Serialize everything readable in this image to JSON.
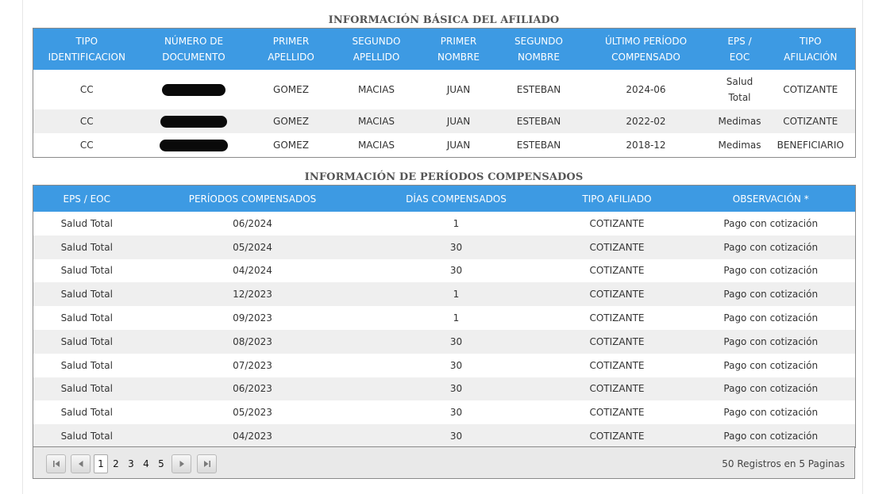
{
  "basic_section": {
    "title": "INFORMACIÓN BÁSICA DEL AFILIADO",
    "headers": [
      "TIPO\nIDENTIFICACION",
      "NÚMERO DE\nDOCUMENTO",
      "PRIMER\nAPELLIDO",
      "SEGUNDO\nAPELLIDO",
      "PRIMER\nNOMBRE",
      "SEGUNDO\nNOMBRE",
      "ÚLTIMO PERÍODO\nCOMPENSADO",
      "EPS /\nEOC",
      "TIPO\nAFILIACIÓN"
    ],
    "rows": [
      {
        "tipo": "CC",
        "primer_apellido": "GOMEZ",
        "segundo_apellido": "MACIAS",
        "primer_nombre": "JUAN",
        "segundo_nombre": "ESTEBAN",
        "ultimo_periodo": "2024-06",
        "eps": "Salud\nTotal",
        "tipo_afiliacion": "COTIZANTE"
      },
      {
        "tipo": "CC",
        "primer_apellido": "GOMEZ",
        "segundo_apellido": "MACIAS",
        "primer_nombre": "JUAN",
        "segundo_nombre": "ESTEBAN",
        "ultimo_periodo": "2022-02",
        "eps": "Medimas",
        "tipo_afiliacion": "COTIZANTE"
      },
      {
        "tipo": "CC",
        "primer_apellido": "GOMEZ",
        "segundo_apellido": "MACIAS",
        "primer_nombre": "JUAN",
        "segundo_nombre": "ESTEBAN",
        "ultimo_periodo": "2018-12",
        "eps": "Medimas",
        "tipo_afiliacion": "BENEFICIARIO"
      }
    ]
  },
  "periods_section": {
    "title": "INFORMACIÓN DE PERÍODOS COMPENSADOS",
    "headers": [
      "EPS / EOC",
      "PERÍODOS COMPENSADOS",
      "DÍAS COMPENSADOS",
      "TIPO AFILIADO",
      "OBSERVACIÓN *"
    ],
    "rows": [
      {
        "eps": "Salud Total",
        "periodo": "06/2024",
        "dias": "1",
        "tipo": "COTIZANTE",
        "obs": "Pago con cotización"
      },
      {
        "eps": "Salud Total",
        "periodo": "05/2024",
        "dias": "30",
        "tipo": "COTIZANTE",
        "obs": "Pago con cotización"
      },
      {
        "eps": "Salud Total",
        "periodo": "04/2024",
        "dias": "30",
        "tipo": "COTIZANTE",
        "obs": "Pago con cotización"
      },
      {
        "eps": "Salud Total",
        "periodo": "12/2023",
        "dias": "1",
        "tipo": "COTIZANTE",
        "obs": "Pago con cotización"
      },
      {
        "eps": "Salud Total",
        "periodo": "09/2023",
        "dias": "1",
        "tipo": "COTIZANTE",
        "obs": "Pago con cotización"
      },
      {
        "eps": "Salud Total",
        "periodo": "08/2023",
        "dias": "30",
        "tipo": "COTIZANTE",
        "obs": "Pago con cotización"
      },
      {
        "eps": "Salud Total",
        "periodo": "07/2023",
        "dias": "30",
        "tipo": "COTIZANTE",
        "obs": "Pago con cotización"
      },
      {
        "eps": "Salud Total",
        "periodo": "06/2023",
        "dias": "30",
        "tipo": "COTIZANTE",
        "obs": "Pago con cotización"
      },
      {
        "eps": "Salud Total",
        "periodo": "05/2023",
        "dias": "30",
        "tipo": "COTIZANTE",
        "obs": "Pago con cotización"
      },
      {
        "eps": "Salud Total",
        "periodo": "04/2023",
        "dias": "30",
        "tipo": "COTIZANTE",
        "obs": "Pago con cotización"
      }
    ]
  },
  "pager": {
    "pages": [
      "1",
      "2",
      "3",
      "4",
      "5"
    ],
    "current_page": "1",
    "summary": "50 Registros en 5 Paginas",
    "icons": [
      "first-page-icon",
      "prev-page-icon",
      "next-page-icon",
      "last-page-icon"
    ]
  },
  "colors": {
    "header_bg": "#3d9ae3",
    "row_alt_bg": "#efefef",
    "pager_bg": "#e9e9e9"
  }
}
